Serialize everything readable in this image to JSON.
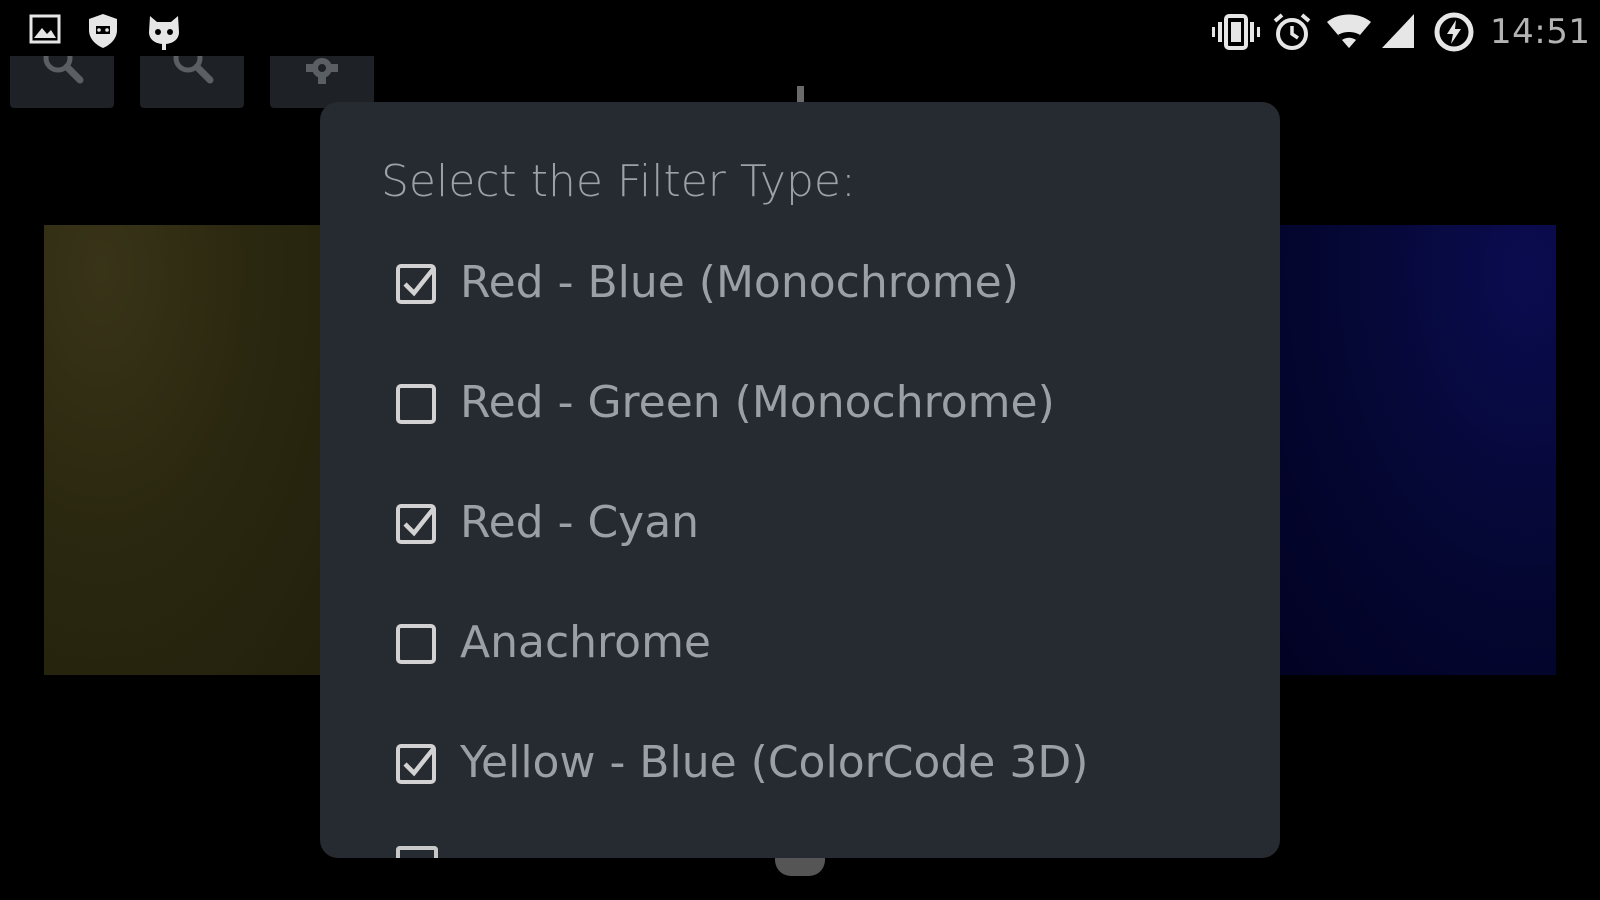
{
  "status_bar": {
    "icons": [
      "image-notification-icon",
      "shield-notification-icon",
      "cat-notification-icon",
      "vibrate-icon",
      "alarm-icon",
      "wifi-icon",
      "cell-signal-icon",
      "sync-icon"
    ],
    "time": "14:51"
  },
  "toolbar": {
    "buttons": [
      "zoom-in-icon",
      "zoom-out-icon",
      "settings-gear-icon"
    ]
  },
  "dialog": {
    "title": "Select the Filter Type:",
    "options": [
      {
        "label": "Red - Blue (Monochrome)",
        "checked": true
      },
      {
        "label": "Red - Green (Monochrome)",
        "checked": false
      },
      {
        "label": "Red - Cyan",
        "checked": true
      },
      {
        "label": "Anachrome",
        "checked": false
      },
      {
        "label": "Yellow - Blue (ColorCode 3D)",
        "checked": true
      }
    ]
  },
  "colors": {
    "dialog_background": "#252b31",
    "text": "#9aa0a5",
    "checkbox": "#d2d2d2",
    "screen_background": "#000000"
  }
}
